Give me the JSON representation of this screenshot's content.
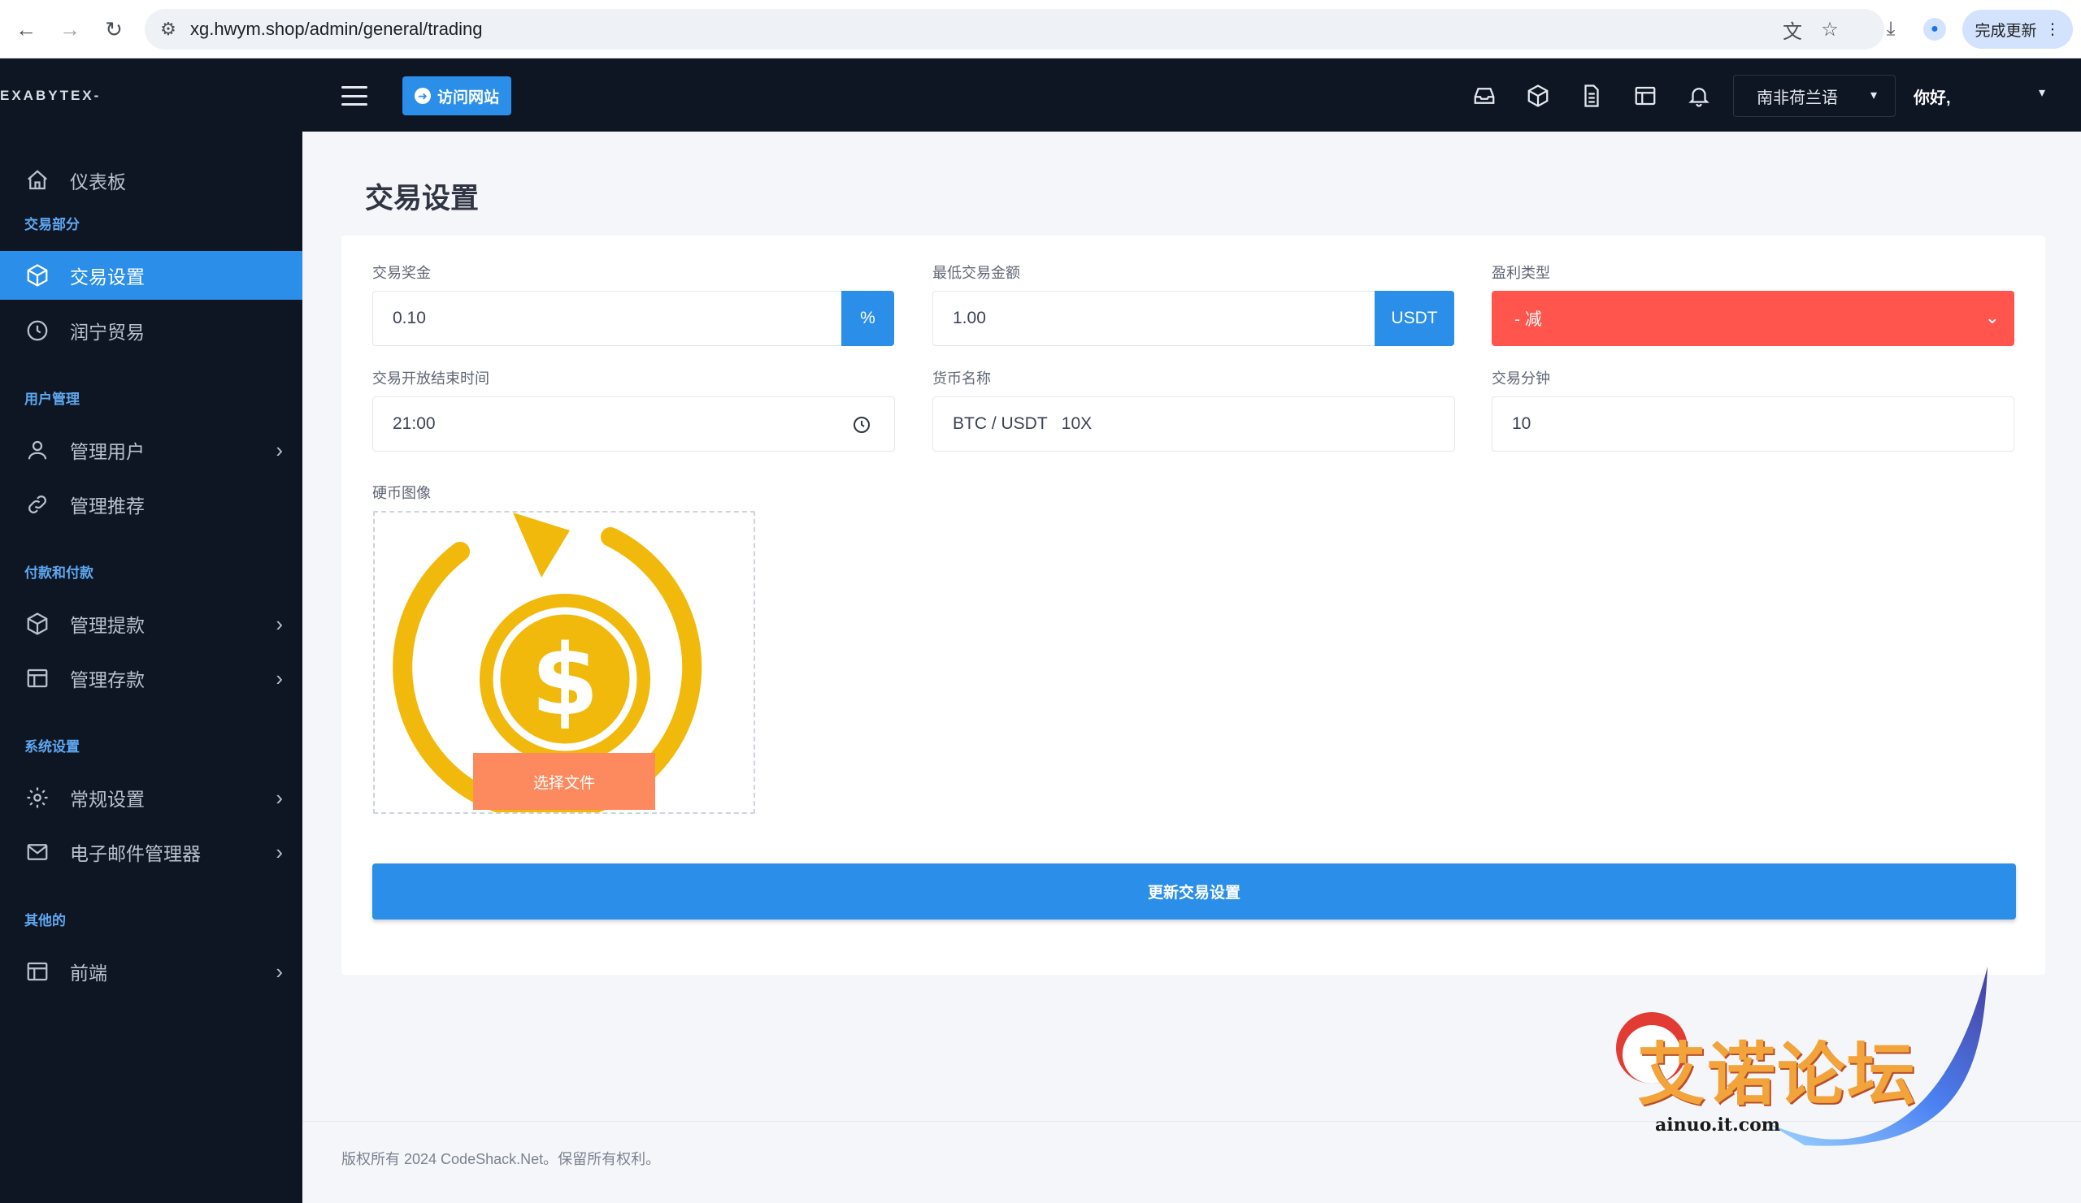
{
  "browser": {
    "url": "xg.hwym.shop/admin/general/trading",
    "update_label": "完成更新"
  },
  "sidebar": {
    "brand": "EXABYTEX-",
    "dashboard": "仪表板",
    "sections": {
      "trade": "交易部分",
      "users": "用户管理",
      "payments": "付款和付款",
      "system": "系统设置",
      "other": "其他的"
    },
    "items": {
      "trade_settings": "交易设置",
      "runing_trade": "润宁贸易",
      "manage_users": "管理用户",
      "manage_referrals": "管理推荐",
      "manage_withdrawals": "管理提款",
      "manage_deposits": "管理存款",
      "general_settings": "常规设置",
      "email_manager": "电子邮件管理器",
      "frontend": "前端"
    }
  },
  "topbar": {
    "visit_site": "访问网站",
    "language": "南非荷兰语",
    "greeting": "你好,"
  },
  "page": {
    "title": "交易设置"
  },
  "form": {
    "trade_bonus_label": "交易奖金",
    "trade_bonus_value": "0.10",
    "trade_bonus_addon": "%",
    "min_amount_label": "最低交易金额",
    "min_amount_value": "1.00",
    "min_amount_addon": "USDT",
    "profit_type_label": "盈利类型",
    "profit_type_value": "- 减",
    "open_close_label": "交易开放结束时间",
    "open_close_value": "21:00",
    "currency_label": "货币名称",
    "currency_value": "BTC / USDT   10X",
    "trade_minutes_label": "交易分钟",
    "trade_minutes_value": "10",
    "coin_image_label": "硬币图像",
    "choose_file": "选择文件",
    "submit": "更新交易设置"
  },
  "footer": {
    "text": "版权所有 2024 CodeShack.Net。保留所有权利。"
  },
  "watermark": {
    "title": "艾诺论坛",
    "site": "ainuo.it.com"
  },
  "colors": {
    "accent": "#2b8ee8",
    "sidebar_bg": "#0e1624",
    "profit_select": "#ff554d",
    "file_button": "#fd8a5e",
    "coin": "#f0b90b"
  }
}
